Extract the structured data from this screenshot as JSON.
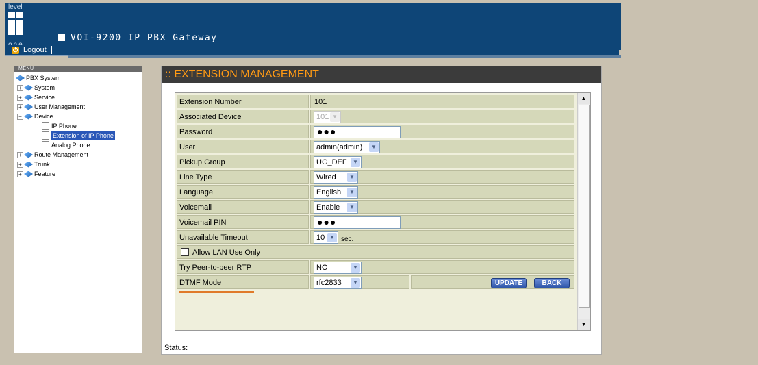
{
  "brand": {
    "logo_top": "level",
    "logo_bottom": "one",
    "product": "VOI-9200 IP PBX Gateway"
  },
  "header": {
    "logout_label": "Logout"
  },
  "menu": {
    "title": "MENU",
    "root": "PBX System",
    "items": [
      {
        "label": "System",
        "expanded": false
      },
      {
        "label": "Service",
        "expanded": false
      },
      {
        "label": "User Management",
        "expanded": false
      },
      {
        "label": "Device",
        "expanded": true,
        "children": [
          "IP Phone",
          "Extension of IP Phone",
          "Analog Phone"
        ],
        "selected": "Extension of IP Phone"
      },
      {
        "label": "Route Management",
        "expanded": false
      },
      {
        "label": "Trunk",
        "expanded": false
      },
      {
        "label": "Feature",
        "expanded": false
      }
    ]
  },
  "page": {
    "title": ":: EXTENSION MANAGEMENT",
    "status_label": "Status:"
  },
  "form": {
    "extension_number": {
      "label": "Extension Number",
      "value": "101"
    },
    "associated_device": {
      "label": "Associated Device",
      "value": "101"
    },
    "password": {
      "label": "Password",
      "value": "●●●"
    },
    "user": {
      "label": "User",
      "value": "admin(admin)"
    },
    "pickup_group": {
      "label": "Pickup Group",
      "value": "UG_DEF"
    },
    "line_type": {
      "label": "Line Type",
      "value": "Wired"
    },
    "language": {
      "label": "Language",
      "value": "English"
    },
    "voicemail": {
      "label": "Voicemail",
      "value": "Enable"
    },
    "voicemail_pin": {
      "label": "Voicemail PIN",
      "value": "●●●"
    },
    "unavailable_timeout": {
      "label": "Unavailable Timeout",
      "value": "10",
      "unit": "sec."
    },
    "allow_lan": {
      "label": "Allow LAN Use Only",
      "checked": false
    },
    "peer_rtp": {
      "label": "Try Peer-to-peer RTP",
      "value": "NO"
    },
    "dtmf_mode": {
      "label": "DTMF Mode",
      "value": "rfc2833"
    },
    "buttons": {
      "update": "UPDATE",
      "back": "BACK"
    }
  },
  "colors": {
    "header": "#0e4577",
    "title_text": "#ff9a14",
    "row_bg": "#d5d8b9"
  }
}
